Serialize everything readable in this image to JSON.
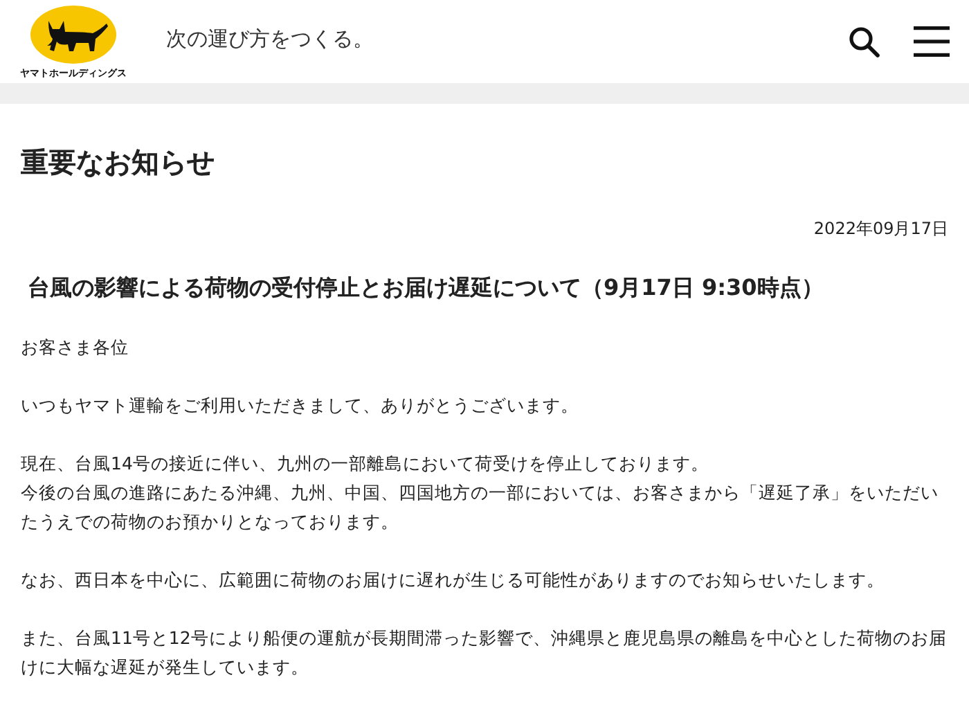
{
  "header": {
    "logo_text": "ヤマトホールディングス",
    "tagline": "次の運び方をつくる。"
  },
  "page_title": "重要なお知らせ",
  "notice": {
    "date": "2022年09月17日",
    "headline": "台風の影響による荷物の受付停止とお届け遅延について（9月17日 9:30時点）",
    "paragraphs": [
      [
        "お客さま各位"
      ],
      [
        "いつもヤマト運輸をご利用いただきまして、ありがとうございます。"
      ],
      [
        "現在、台風14号の接近に伴い、九州の一部離島において荷受けを停止しております。",
        "今後の台風の進路にあたる沖縄、九州、中国、四国地方の一部においては、お客さまから「遅延了承」をいただいたうえでの荷物のお預かりとなっております。"
      ],
      [
        "なお、西日本を中心に、広範囲に荷物のお届けに遅れが生じる可能性がありますのでお知らせいたします。"
      ],
      [
        "また、台風11号と12号により船便の運航が長期間滞った影響で、沖縄県と鹿児島県の離島を中心とした荷物のお届けに大幅な遅延が発生しています。"
      ]
    ]
  }
}
